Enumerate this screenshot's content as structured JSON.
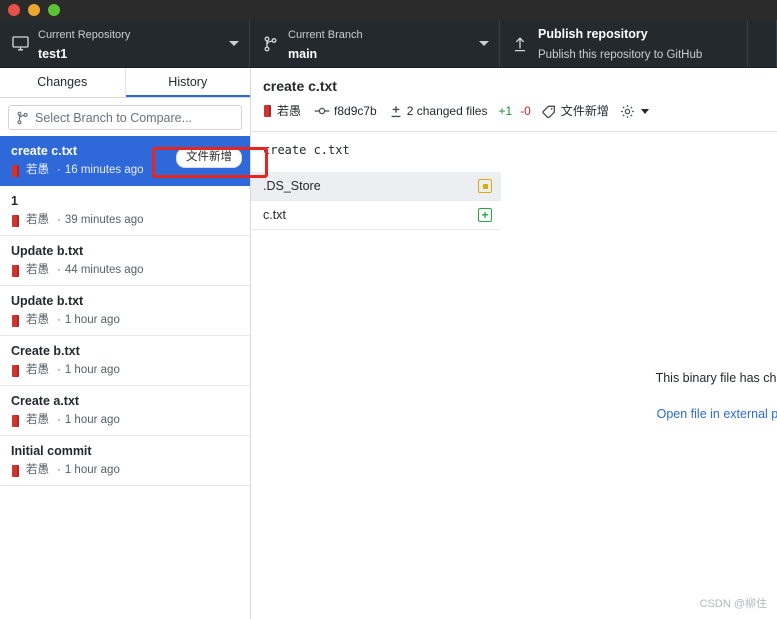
{
  "window": {
    "traffic_lights": [
      "close",
      "minimize",
      "maximize"
    ],
    "colors": {
      "close": "#e8504a",
      "minimize": "#e9a82e",
      "maximize": "#5cc234",
      "toolbar_bg": "#24292e",
      "accent": "#2b6cd4",
      "selected_row": "#2f68d8",
      "annotation": "#e8251f"
    }
  },
  "toolbar": {
    "repository": {
      "label": "Current Repository",
      "value": "test1",
      "icon": "repository-desktop-icon"
    },
    "branch": {
      "label": "Current Branch",
      "value": "main",
      "icon": "branch-icon"
    },
    "publish": {
      "label": "Publish repository",
      "value": "Publish this repository to GitHub",
      "icon": "upload-icon"
    }
  },
  "sidebar": {
    "tabs": [
      {
        "id": "changes",
        "label": "Changes",
        "active": false
      },
      {
        "id": "history",
        "label": "History",
        "active": true
      }
    ],
    "compare": {
      "placeholder": "Select Branch to Compare...",
      "icon": "branch-icon"
    },
    "commits": [
      {
        "title": "create c.txt",
        "author": "若愚",
        "time": "16 minutes ago",
        "separator": "·",
        "tag": "文件新增",
        "selected": true
      },
      {
        "title": "1",
        "author": "若愚",
        "time": "39 minutes ago",
        "separator": "·",
        "tag": "",
        "selected": false
      },
      {
        "title": "Update b.txt",
        "author": "若愚",
        "time": "44 minutes ago",
        "separator": "·",
        "tag": "",
        "selected": false
      },
      {
        "title": "Update b.txt",
        "author": "若愚",
        "time": "1 hour ago",
        "separator": "·",
        "tag": "",
        "selected": false
      },
      {
        "title": "Create b.txt",
        "author": "若愚",
        "time": "1 hour ago",
        "separator": "·",
        "tag": "",
        "selected": false
      },
      {
        "title": "Create a.txt",
        "author": "若愚",
        "time": "1 hour ago",
        "separator": "·",
        "tag": "",
        "selected": false
      },
      {
        "title": "Initial commit",
        "author": "若愚",
        "time": "1 hour ago",
        "separator": "·",
        "tag": "",
        "selected": false
      }
    ]
  },
  "commit_summary": {
    "title": "create c.txt",
    "author": "若愚",
    "sha": "f8d9c7b",
    "changed_files": "2 changed files",
    "additions": "+1",
    "deletions": "-0",
    "tag": "文件新增",
    "gear_icon": "gear-icon"
  },
  "commit_message": "create c.txt",
  "files": [
    {
      "name": ".DS_Store",
      "status": "modified",
      "status_icon": "modified-dot-icon",
      "selected": true
    },
    {
      "name": "c.txt",
      "status": "added",
      "status_icon": "plus-icon",
      "selected": false
    }
  ],
  "diff_panel": {
    "message": "This binary file has cha",
    "link": "Open file in external pr"
  },
  "annotations": [
    {
      "id": "annot-tag",
      "type": "rectangle",
      "color": "#e8251f",
      "targets": "commit-tag"
    }
  ],
  "watermark": "CSDN @柳住"
}
